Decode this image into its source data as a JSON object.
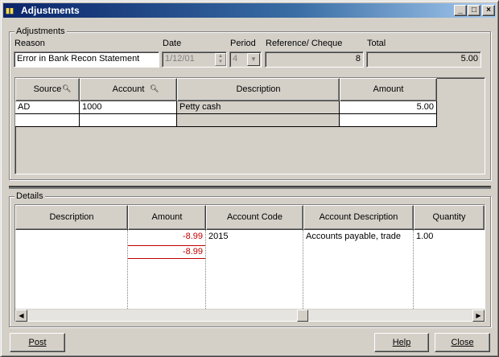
{
  "window": {
    "title": "Adjustments",
    "app_icon": "app-icon",
    "buttons": {
      "minimize": "_",
      "maximize": "□",
      "close": "×"
    }
  },
  "adjustments": {
    "group_label": "Adjustments",
    "reason_label": "Reason",
    "reason_value": "Error in Bank Recon Statement",
    "date_label": "Date",
    "date_value": "1/12/01",
    "period_label": "Period",
    "period_value": "4",
    "reference_label": "Reference/ Cheque",
    "reference_value": "8",
    "total_label": "Total",
    "total_value": "5.00",
    "grid": {
      "headers": [
        "Source",
        "Account",
        "Description",
        "Amount"
      ],
      "rows": [
        {
          "source": "AD",
          "account": "1000",
          "description": "Petty cash",
          "amount": "5.00"
        },
        {
          "source": "",
          "account": "",
          "description": "",
          "amount": ""
        }
      ]
    }
  },
  "details": {
    "group_label": "Details",
    "headers": [
      "Description",
      "Amount",
      "Account Code",
      "Account Description",
      "Quantity"
    ],
    "rows": [
      {
        "description": "",
        "amount": "-8.99",
        "account_code": "2015",
        "account_description": "Accounts payable, trade",
        "quantity": "1.00"
      }
    ],
    "amount_subtotal": "-8.99",
    "amount_color": "#c00000"
  },
  "footer": {
    "post_label": "Post",
    "help_label": "Help",
    "close_label": "Close"
  }
}
